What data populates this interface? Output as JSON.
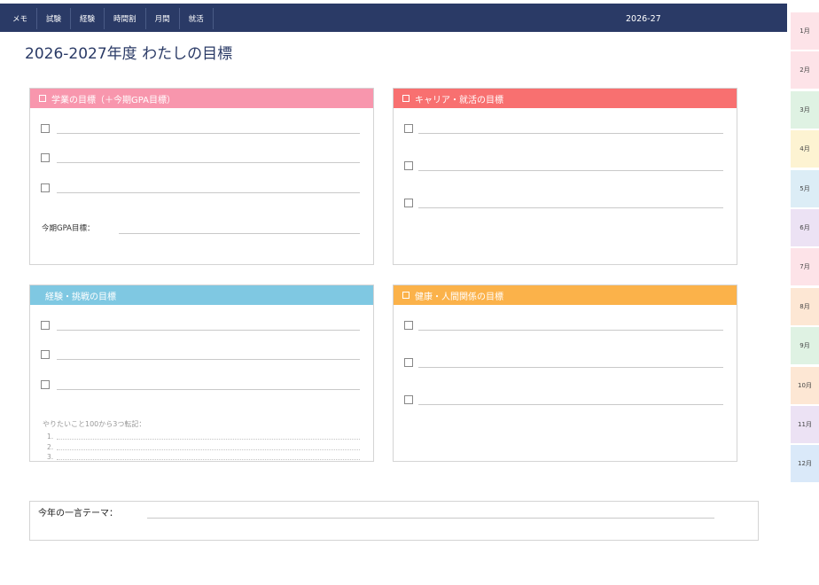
{
  "nav": {
    "items": [
      "メモ",
      "試験",
      "経験",
      "時間割",
      "月間",
      "就活"
    ],
    "year": "2026-27"
  },
  "page_title": "2026-2027年度 わたしの目標",
  "months": [
    "1月",
    "2月",
    "3月",
    "4月",
    "5月",
    "6月",
    "7月",
    "8月",
    "9月",
    "10月",
    "11月",
    "12月"
  ],
  "month_colors": [
    "#fde3e8",
    "#fde3e8",
    "#dff2e3",
    "#fdf3d2",
    "#dcedf6",
    "#ece2f4",
    "#fde3e8",
    "#fde7d4",
    "#dff2e3",
    "#fde7d4",
    "#ece2f4",
    "#dae9f9"
  ],
  "cards": {
    "academic": {
      "title": "学業の目標（＋今期GPA目標）",
      "color": "#f896ad",
      "gpa_label": "今期GPA目標："
    },
    "career": {
      "title": "キャリア・就活の目標",
      "color": "#f87070"
    },
    "experience": {
      "title": "経験・挑戦の目標",
      "color": "#7fc8e2",
      "bucket_label": "やりたいこと100から3つ転記：",
      "bucket_items": [
        "1.",
        "2.",
        "3."
      ]
    },
    "health": {
      "title": "健康・人間関係の目標",
      "color": "#fbb24a"
    }
  },
  "theme": {
    "label": "今年の一言テーマ："
  }
}
